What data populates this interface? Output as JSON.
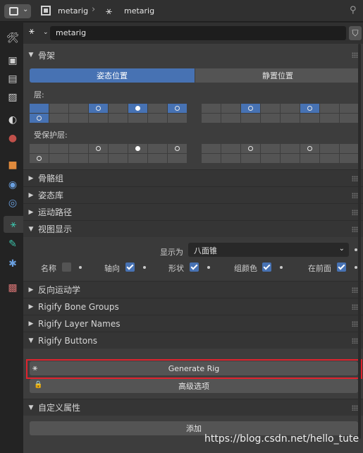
{
  "header": {
    "breadcrumb": [
      "metarig",
      "metarig"
    ],
    "icons": [
      "editor-type-icon",
      "chevron-down-icon",
      "object-icon",
      "armature-icon",
      "pin-icon"
    ]
  },
  "sidebar": {
    "tabs": [
      {
        "name": "tool",
        "icon": "wrench-screwdriver-icon",
        "glyph": "🔧"
      },
      {
        "name": "render",
        "icon": "camera-icon",
        "glyph": "▣"
      },
      {
        "name": "output",
        "icon": "printer-icon",
        "glyph": "▤"
      },
      {
        "name": "view-layer",
        "icon": "image-icon",
        "glyph": "▨"
      },
      {
        "name": "scene",
        "icon": "scene-icon",
        "glyph": "◐"
      },
      {
        "name": "world",
        "icon": "world-icon",
        "glyph": "●"
      },
      {
        "name": "object",
        "icon": "object-cube-icon",
        "glyph": "■"
      },
      {
        "name": "modifiers",
        "icon": "physics-icon",
        "glyph": "◉"
      },
      {
        "name": "constraints",
        "icon": "orbit-icon",
        "glyph": "◎"
      },
      {
        "name": "armature-data",
        "icon": "armature-icon",
        "glyph": "⚹"
      },
      {
        "name": "bone",
        "icon": "bone-icon",
        "glyph": "✎"
      },
      {
        "name": "bone-constraints",
        "icon": "bone-constraint-icon",
        "glyph": "✱"
      },
      {
        "name": "texture",
        "icon": "checker-icon",
        "glyph": "▩"
      }
    ]
  },
  "object_field": {
    "value": "metarig"
  },
  "skeleton_panel": {
    "title": "骨架",
    "pose_position": "姿态位置",
    "rest_position": "静置位置",
    "layers_label": "层:",
    "protected_layers_label": "受保护层:"
  },
  "collapsed_panels": [
    "骨骼组",
    "姿态库",
    "运动路径"
  ],
  "viewport_display": {
    "title": "视图显示",
    "display_as_label": "显示为",
    "display_as_value": "八面锥",
    "names_label": "名称",
    "axes_label": "轴向",
    "shapes_label": "形状",
    "group_colors_label": "组颜色",
    "in_front_label": "在前面",
    "names_checked": false,
    "axes_checked": true,
    "shapes_checked": true,
    "group_colors_checked": true,
    "in_front_checked": true
  },
  "more_panels": [
    "反向运动学",
    "Rigify Bone Groups",
    "Rigify Layer Names",
    "Rigify Buttons"
  ],
  "rigify": {
    "generate_label": "Generate Rig",
    "advanced_label": "高级选项"
  },
  "custom_props": {
    "title": "自定义属性",
    "add_label": "添加"
  },
  "watermark": "https://blog.csdn.net/hello_tute",
  "colors": {
    "accent": "#4772b3",
    "highlight": "#e0232e"
  }
}
